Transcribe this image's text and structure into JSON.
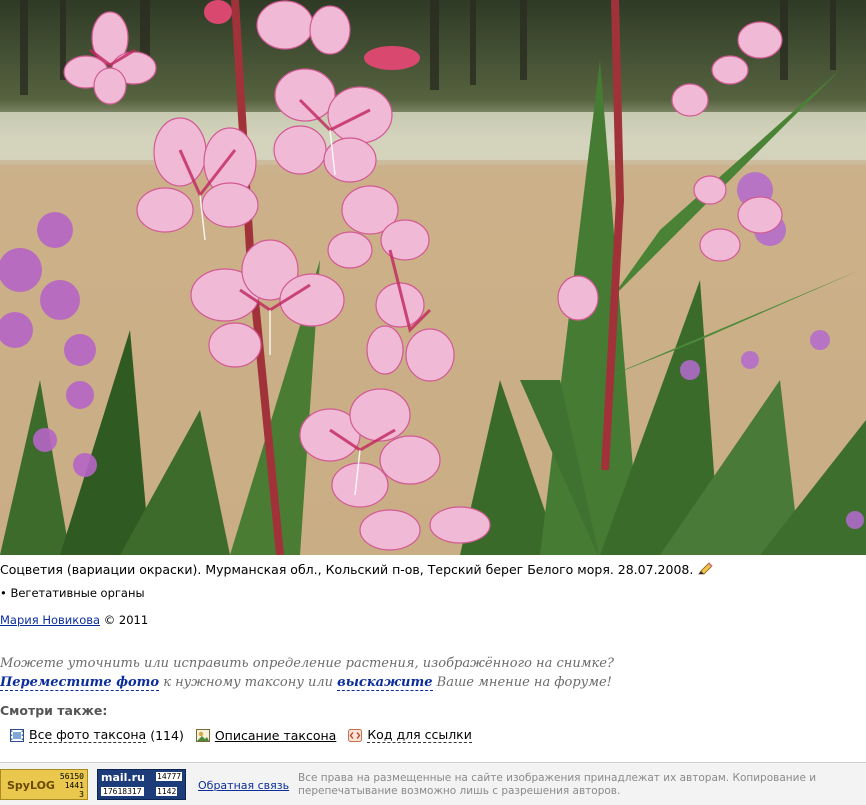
{
  "caption": {
    "text": "Соцветия (вариации окраски). Мурманская обл., Кольский п-ов, Терский берег Белого моря. 28.07.2008."
  },
  "organ_link": "• Вегетативные органы",
  "author": {
    "name": "Мария Новикова",
    "copyright": "© 2011"
  },
  "suggest": {
    "line1": "Можете уточнить или исправить определение растения, изображённого на снимке?",
    "move_link": "Переместите фото",
    "mid": "к нужному таксону или",
    "forum_link": "выскажите",
    "tail": "Ваше мнение на форуме!"
  },
  "see_also": {
    "title": "Смотри также:",
    "all_photos": "Все фото таксона",
    "all_photos_count": "(114)",
    "description": "Описание таксона",
    "code": "Код для ссылки"
  },
  "footer": {
    "spylog": {
      "logo": "SpyLOG",
      "n1": "56150",
      "n2": "1441",
      "n3": "3"
    },
    "mail": {
      "logo": "mail.ru",
      "n1": "14777",
      "n2": "17618317",
      "n3": "1142"
    },
    "feedback": "Обратная связь",
    "rights": "Все права на размещенные на сайте изображения принадлежат их авторам. Копирование и перепечатывание возможно лишь с разрешения авторов."
  }
}
